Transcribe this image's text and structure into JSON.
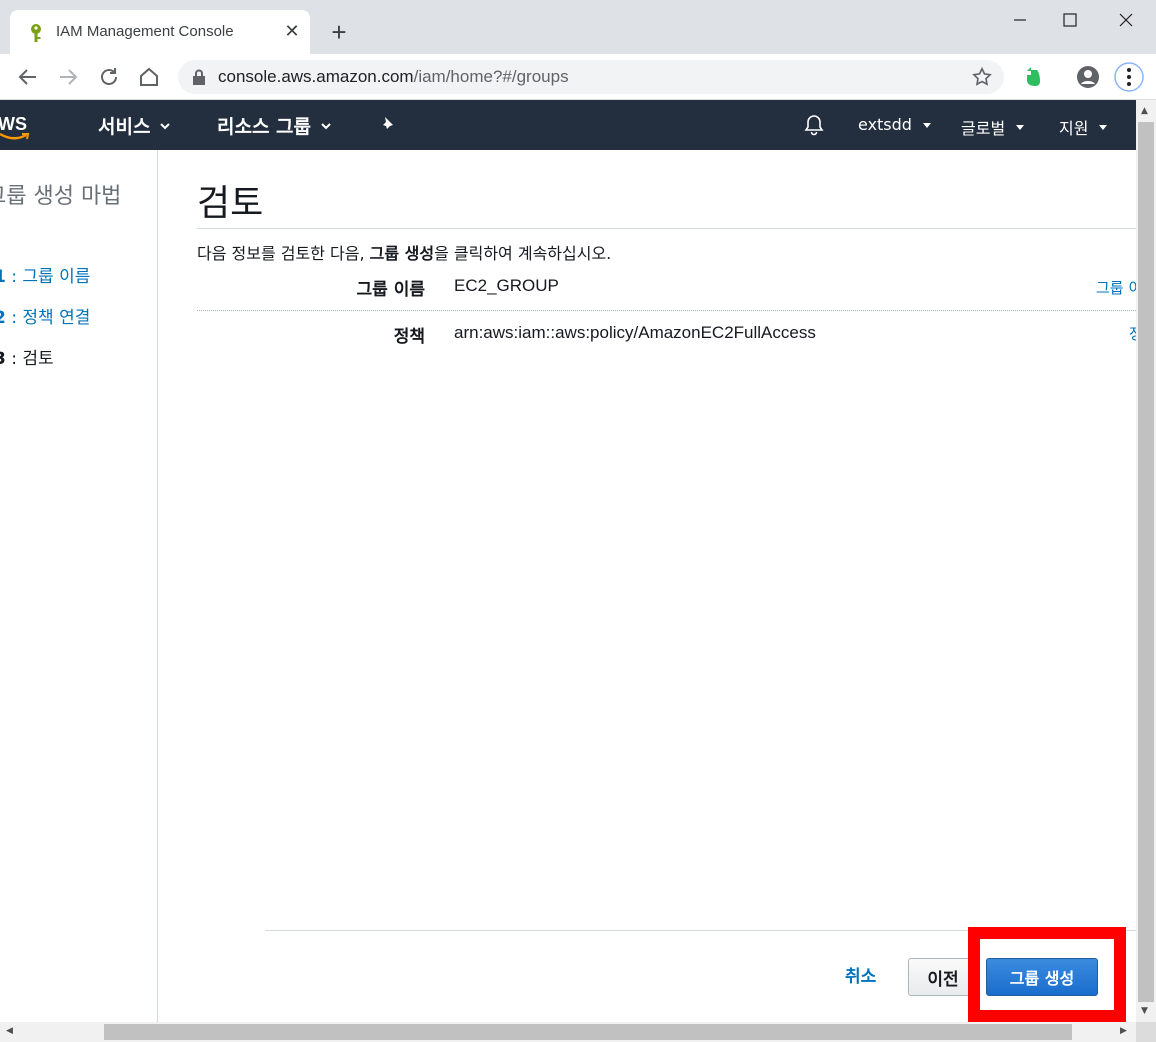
{
  "browser": {
    "tab_title": "IAM Management Console",
    "url_domain": "console.aws.amazon.com",
    "url_path": "/iam/home?#/groups"
  },
  "aws_nav": {
    "logo_text": "WS",
    "services": "서비스",
    "resource_groups": "리소스 그룹",
    "account": "extsdd",
    "region": "글로벌",
    "support": "지원"
  },
  "sidebar": {
    "title": "그룹 생성 마법",
    "steps": [
      {
        "num": "1",
        "label": " : 그룹 이름"
      },
      {
        "num": "2",
        "label": " : 정책 연결"
      },
      {
        "num": "3",
        "label": " : 검토"
      }
    ]
  },
  "main": {
    "title": "검토",
    "intro_prefix": "다음 정보를 검토한 다음, ",
    "intro_bold": "그룹 생성",
    "intro_suffix": "을 클릭하여 계속하십시오.",
    "rows": [
      {
        "label": "그룹 이름",
        "value": "EC2_GROUP",
        "edit_link": "그룹 이"
      },
      {
        "label": "정책",
        "value": "arn:aws:iam::aws:policy/AmazonEC2FullAccess",
        "edit_link": "정"
      }
    ]
  },
  "footer": {
    "cancel": "취소",
    "previous": "이전",
    "create": "그룹 생성"
  },
  "colors": {
    "aws_nav_bg": "#232f3e",
    "link": "#0073bb",
    "primary_button": "#1a6dcc",
    "highlight": "#ff0000"
  }
}
